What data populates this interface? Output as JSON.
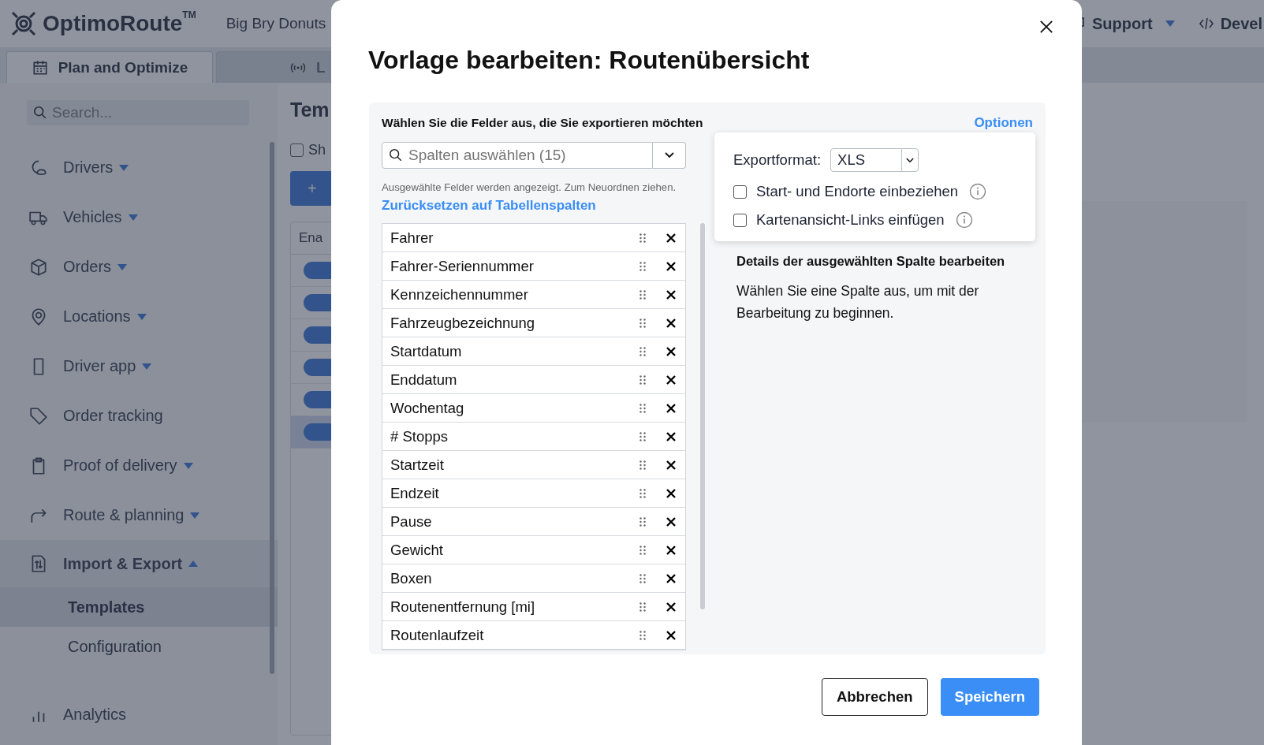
{
  "header": {
    "brand": "OptimoRoute",
    "trademark": "TM",
    "account": "Big Bry Donuts",
    "nav": [
      {
        "label": "Support",
        "has_menu": true
      },
      {
        "label": "Devel",
        "has_menu": false
      }
    ]
  },
  "tabs": [
    {
      "label": "Plan and Optimize",
      "selected": true
    },
    {
      "label": "L",
      "selected": false
    }
  ],
  "sidebar": {
    "search": {
      "placeholder": "Search..."
    },
    "items": [
      {
        "label": "Drivers",
        "kind": "group",
        "expanded": false
      },
      {
        "label": "Vehicles",
        "kind": "group",
        "expanded": false
      },
      {
        "label": "Orders",
        "kind": "group",
        "expanded": false
      },
      {
        "label": "Locations",
        "kind": "group",
        "expanded": false
      },
      {
        "label": "Driver app",
        "kind": "group",
        "expanded": false
      },
      {
        "label": "Order tracking",
        "kind": "link"
      },
      {
        "label": "Proof of delivery",
        "kind": "group",
        "expanded": false
      },
      {
        "label": "Route & planning",
        "kind": "group",
        "expanded": false
      },
      {
        "label": "Import & Export",
        "kind": "group",
        "expanded": true,
        "children": [
          {
            "label": "Templates",
            "selected": true
          },
          {
            "label": "Configuration",
            "selected": false
          }
        ]
      },
      {
        "label": "Analytics",
        "kind": "link"
      }
    ]
  },
  "content": {
    "title": "Tem",
    "checkbox": {
      "label": "Sh",
      "checked": false
    },
    "add_button": "+",
    "table": {
      "column_1": "Ena",
      "rows": [
        {
          "on": true,
          "selected": false
        },
        {
          "on": true,
          "selected": false
        },
        {
          "on": true,
          "selected": false
        },
        {
          "on": true,
          "selected": false
        },
        {
          "on": true,
          "selected": false
        },
        {
          "on": true,
          "selected": true
        }
      ]
    }
  },
  "modal": {
    "title": "Vorlage bearbeiten: Routenübersicht",
    "heading": "Wählen Sie die Felder aus, die Sie exportieren möchten",
    "options_link": "Optionen",
    "column_select": {
      "placeholder": "Spalten auswählen (15)"
    },
    "hint": "Ausgewählte Felder werden angezeigt. Zum Neuordnen ziehen.",
    "reset_link": "Zurücksetzen auf Tabellenspalten",
    "fields": [
      "Fahrer",
      "Fahrer-Seriennummer",
      "Kennzeichennummer",
      "Fahrzeugbezeichnung",
      "Startdatum",
      "Enddatum",
      "Wochentag",
      "# Stopps",
      "Startzeit",
      "Endzeit",
      "Pause",
      "Gewicht",
      "Boxen",
      "Routenentfernung [mi]",
      "Routenlaufzeit"
    ],
    "options": {
      "format_label": "Exportformat:",
      "format_value": "XLS",
      "checkboxes": [
        {
          "label": "Start- und Endorte einbeziehen",
          "checked": false
        },
        {
          "label": "Kartenansicht-Links einfügen",
          "checked": false
        }
      ]
    },
    "details": {
      "heading": "Details der ausgewählten Spalte bearbeiten",
      "text": "Wählen Sie eine Spalte aus, um mit der Bearbeitung zu beginnen."
    },
    "buttons": {
      "cancel": "Abbrechen",
      "save": "Speichern"
    }
  }
}
